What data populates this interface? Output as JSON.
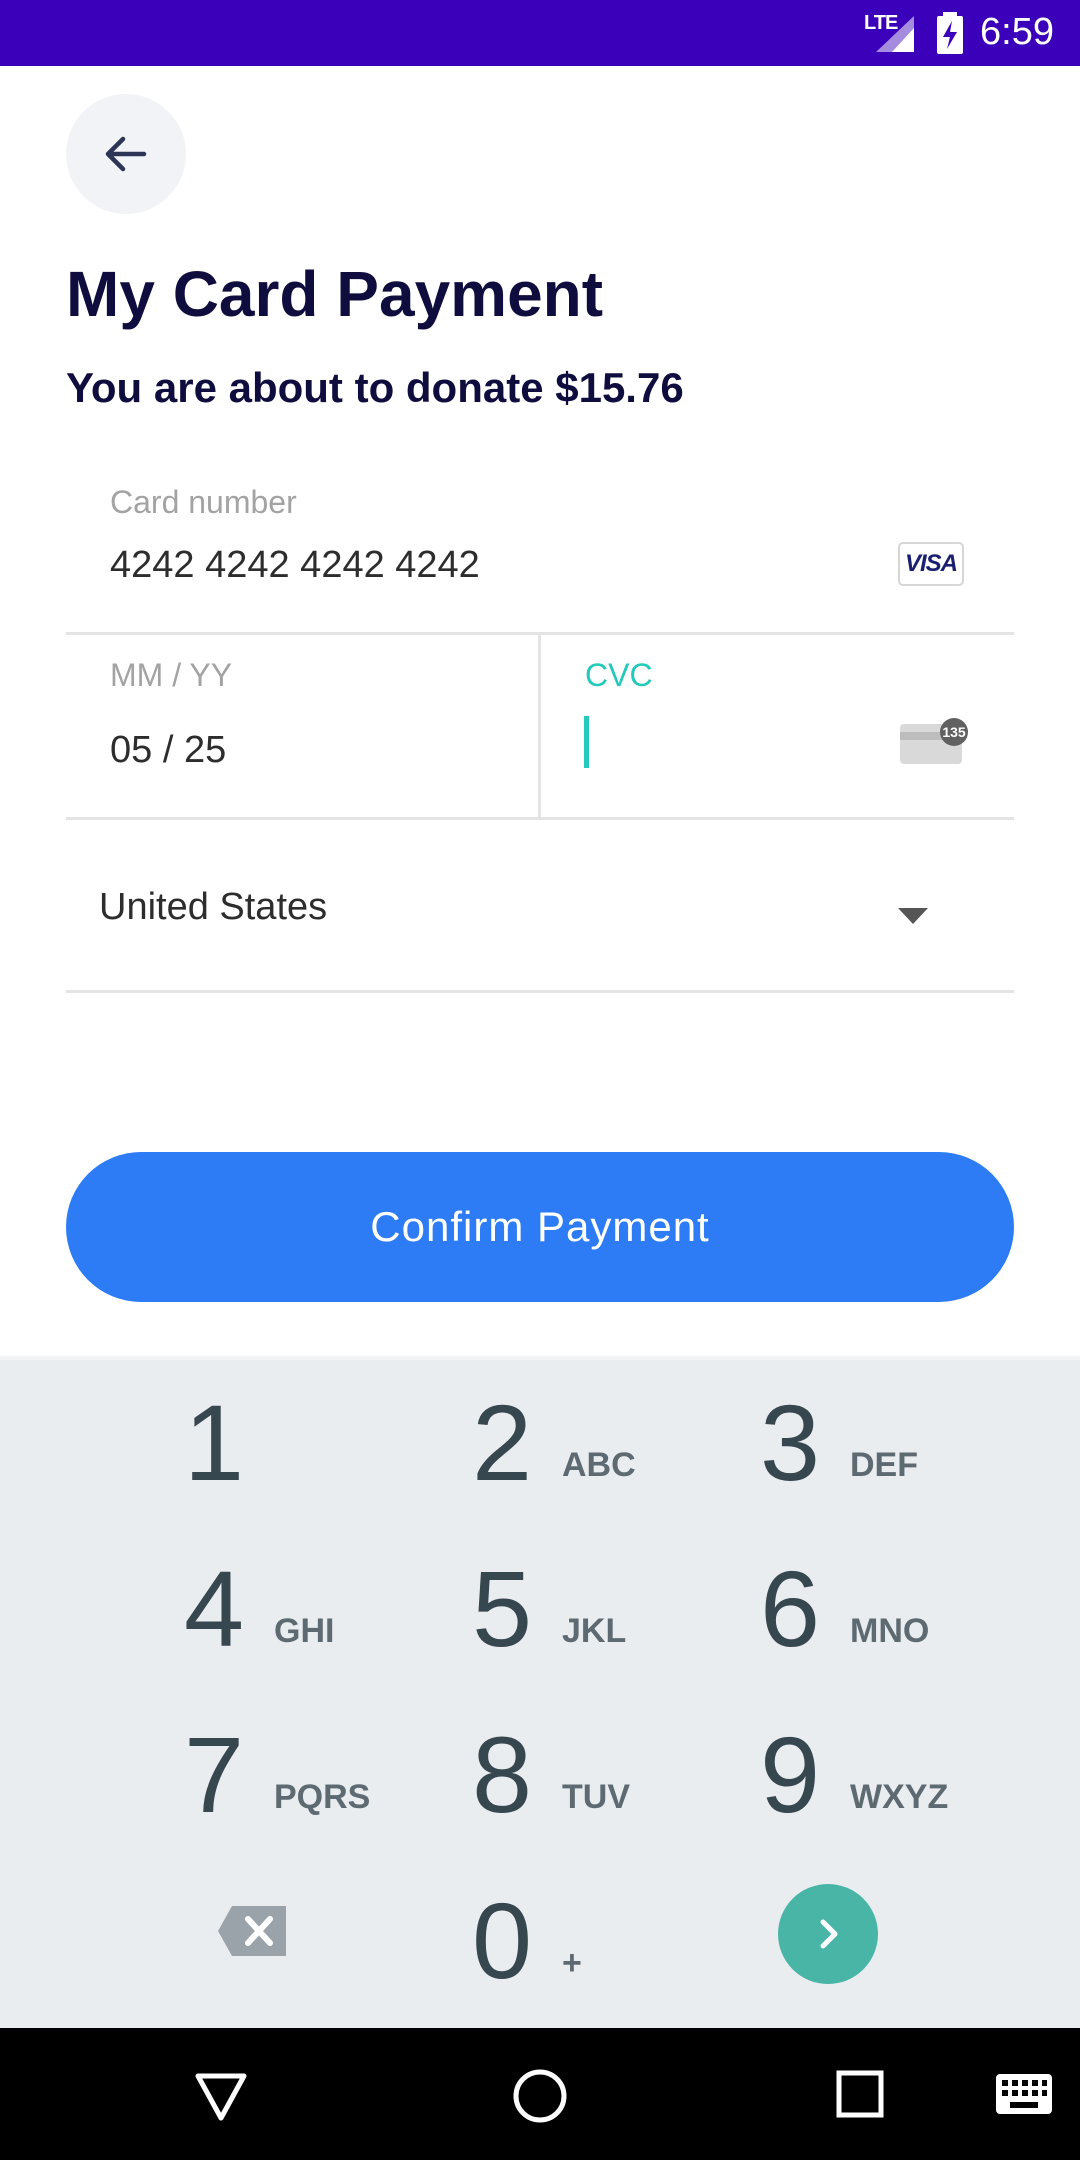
{
  "status_bar": {
    "network": "LTE",
    "time": "6:59"
  },
  "header": {
    "back_icon": "arrow-left-icon",
    "title": "My Card Payment",
    "subtitle": "You are about to donate $15.76"
  },
  "card_form": {
    "card_number_label": "Card number",
    "card_number_value": "4242 4242 4242 4242",
    "card_brand": "VISA",
    "expiry_label": "MM / YY",
    "expiry_value": "05 / 25",
    "cvc_label": "CVC",
    "cvc_value": "",
    "cvc_icon_text": "135",
    "accent_color": "#25c9ba"
  },
  "country": {
    "selected": "United States"
  },
  "confirm": {
    "label": "Confirm Payment",
    "color": "#2d7cf6"
  },
  "keyboard": {
    "keys": [
      {
        "digit": "1",
        "letters": ""
      },
      {
        "digit": "2",
        "letters": "ABC"
      },
      {
        "digit": "3",
        "letters": "DEF"
      },
      {
        "digit": "4",
        "letters": "GHI"
      },
      {
        "digit": "5",
        "letters": "JKL"
      },
      {
        "digit": "6",
        "letters": "MNO"
      },
      {
        "digit": "7",
        "letters": "PQRS"
      },
      {
        "digit": "8",
        "letters": "TUV"
      },
      {
        "digit": "9",
        "letters": "WXYZ"
      },
      {
        "digit": "0",
        "letters": "+"
      }
    ],
    "backspace_icon": "backspace-icon",
    "go_icon": "chevron-right-icon"
  },
  "nav_bar": {
    "back_icon": "triangle-back-icon",
    "home_icon": "circle-home-icon",
    "recents_icon": "square-recents-icon",
    "keyboard_icon": "keyboard-icon"
  }
}
